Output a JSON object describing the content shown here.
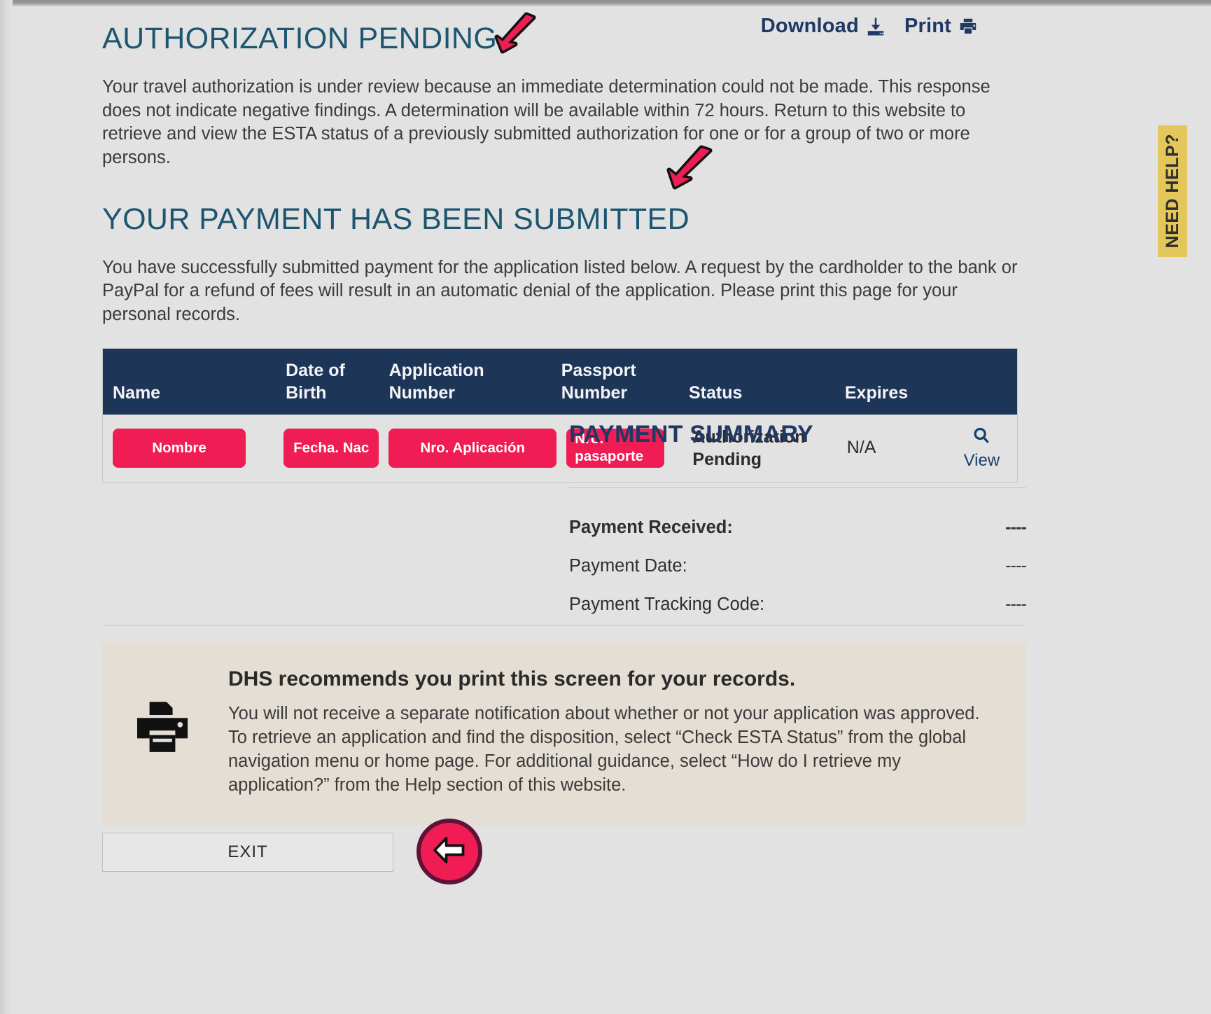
{
  "toolbar": {
    "download_label": "Download",
    "download_icon": "download-icon",
    "print_label": "Print",
    "print_icon": "printer-icon"
  },
  "help_tab": {
    "label": "NEED HELP?",
    "color": "#e3c75b"
  },
  "sections": {
    "pending": {
      "title": "AUTHORIZATION PENDING",
      "body": "Your travel authorization is under review because an immediate determination could not be made. This response does not indicate negative findings. A determination will be available within 72 hours. Return to this website to retrieve and view the ESTA status of a previously submitted authorization for one or for a group of two or more persons."
    },
    "payment_submitted": {
      "title": "YOUR PAYMENT HAS BEEN SUBMITTED",
      "body": "You have successfully submitted payment for the application listed below. A request by the cardholder to the bank or PayPal for a refund of fees will result in an automatic denial of the application. Please print this page for your personal records."
    }
  },
  "table": {
    "headers": {
      "name": "Name",
      "dob_line1": "Date of",
      "dob_line2": "Birth",
      "application_number": "Application Number",
      "passport_line1": "Passport",
      "passport_line2": "Number",
      "status": "Status",
      "expires": "Expires"
    },
    "row": {
      "name": "Nombre",
      "dob": "Fecha. Nac",
      "application_number": "Nro. Aplicación",
      "passport_number": "Nro. pasaporte",
      "status_line1": "Authorization",
      "status_line2": "Pending",
      "expires": "N/A",
      "view_label": "View",
      "view_icon": "magnifier-icon"
    },
    "header_bg": "#1d3557",
    "redaction_color": "#ef1d53"
  },
  "payment_summary": {
    "title": "PAYMENT SUMMARY",
    "rows": [
      {
        "label": "Payment Received:",
        "value": "----"
      },
      {
        "label": "Payment Date:",
        "value": "----"
      },
      {
        "label": "Payment Tracking Code:",
        "value": "----"
      }
    ]
  },
  "dhs_notice": {
    "icon": "printer-icon",
    "heading": "DHS recommends you print this screen for your records.",
    "body": "You will not receive a separate notification about whether or not your application was approved. To retrieve an application and find the disposition, select “Check ESTA Status” from the global navigation menu or home page. For additional guidance, select “How do I retrieve my application?” from the Help section of this website."
  },
  "footer": {
    "exit_label": "EXIT",
    "back_icon": "back-arrow-icon"
  },
  "annotations": {
    "arrow_color": "#ef1d53",
    "arrow_pending": "arrow-pointing-to-authorization-pending",
    "arrow_payment": "arrow-pointing-to-payment-submitted"
  }
}
